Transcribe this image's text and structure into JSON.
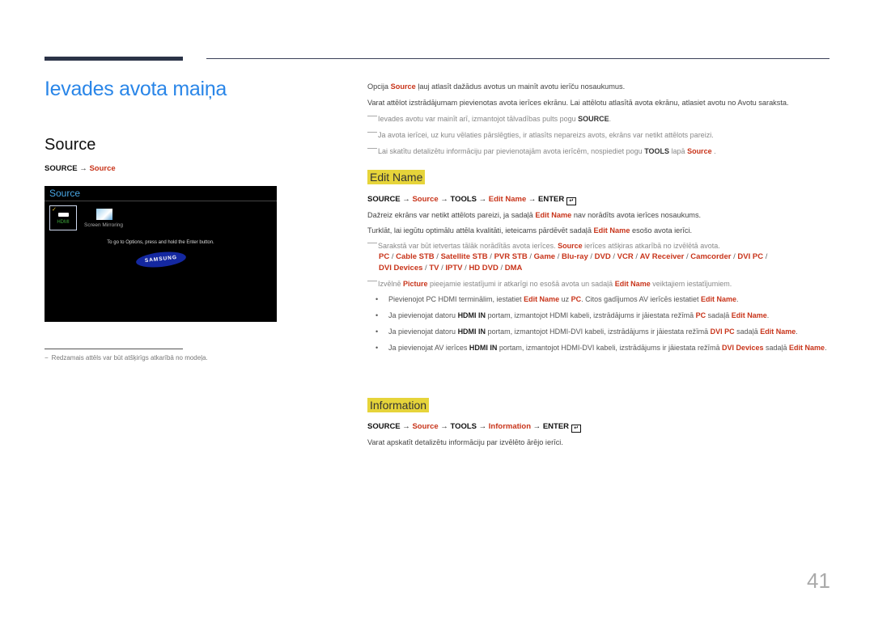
{
  "page_title": "Ievades avota maiņa",
  "section_title": "Source",
  "left_path": {
    "root": "SOURCE",
    "arrow": "→",
    "item": "Source"
  },
  "tv_screen": {
    "title": "Source",
    "hdmi_label": "HDMI",
    "checkmark": "✓",
    "mirror_label": "Screen Mirroring",
    "hint": "To go to Options, press and hold the Enter button.",
    "brand": "SAMSUNG"
  },
  "footnote": {
    "dash": "−",
    "text": "Redzamais attēls var būt atšķirīgs atkarībā no modeļa."
  },
  "intro": {
    "p1_pre": "Opcija ",
    "p1_hl": "Source",
    "p1_post": " ļauj atlasīt dažādus avotus un mainīt avotu ierīču nosaukumus.",
    "p2": "Varat attēlot izstrādājumam pievienotas avota ierīces ekrānu. Lai attēlotu atlasītā avota ekrānu, atlasiet avotu no Avotu saraksta.",
    "n1_pre": "Ievades avotu var mainīt arī, izmantojot tālvadības pults pogu ",
    "n1_b": "SOURCE",
    "n1_post": ".",
    "n2": "Ja avota ierīcei, uz kuru vēlaties pārslēgties, ir atlasīts nepareizs avots, ekrāns var netikt attēlots pareizi.",
    "n3_pre": "Lai skatītu detalizētu informāciju par pievienotajām avota ierīcēm, nospiediet pogu ",
    "n3_b": "TOOLS",
    "n3_mid": " lapā ",
    "n3_hl": "Source",
    "n3_post": " ."
  },
  "edit_name": {
    "heading": "Edit Name",
    "path": [
      "SOURCE",
      "Source",
      "TOOLS",
      "Edit Name",
      "ENTER"
    ],
    "arrow": "→",
    "enter_glyph": "↵",
    "p1_pre": "Dažreiz ekrāns var netikt attēlots pareizi, ja sadaļā ",
    "p1_hl": "Edit Name",
    "p1_post": " nav norādīts avota ierīces nosaukums.",
    "p2_pre": "Turklāt, lai iegūtu optimālu attēla kvalitāti, ieteicams pārdēvēt sadaļā ",
    "p2_hl": "Edit Name",
    "p2_post": " esošo avota ierīci.",
    "n1_pre": "Sarakstā var būt ietvertas tālāk norādītās avota ierīces. ",
    "n1_hl": "Source",
    "n1_post": " ierīces atšķiras atkarībā no izvēlētā avota.",
    "devices": [
      "PC",
      "Cable STB",
      "Satellite STB",
      "PVR STB",
      "Game",
      "Blu-ray",
      "DVD",
      "VCR",
      "AV Receiver",
      "Camcorder",
      "DVI PC",
      "DVI Devices",
      "TV",
      "IPTV",
      "HD DVD",
      "DMA"
    ],
    "n2_pre": "Izvēlnē ",
    "n2_hl1": "Picture",
    "n2_mid": " pieejamie iestatījumi ir atkarīgi no esošā avota un sadaļā ",
    "n2_hl2": "Edit Name",
    "n2_post": " veiktajiem iestatījumiem.",
    "bullets": [
      {
        "a": "Pievienojot PC HDMI terminālim, iestatiet ",
        "b": "Edit Name",
        "c": " uz ",
        "d": "PC",
        "e": ". Citos gadījumos AV ierīcēs iestatiet ",
        "f": "Edit Name",
        "g": "."
      },
      {
        "a": "Ja pievienojat datoru ",
        "b": "HDMI IN",
        "c": " portam, izmantojot HDMI kabeli, izstrādājums ir jāiestata režīmā ",
        "d": "PC",
        "e": " sadaļā ",
        "f": "Edit Name",
        "g": "."
      },
      {
        "a": "Ja pievienojat datoru ",
        "b": "HDMI IN",
        "c": "  portam, izmantojot HDMI-DVI kabeli, izstrādājums ir jāiestata režīmā ",
        "d": "DVI PC",
        "e": " sadaļā ",
        "f": "Edit Name",
        "g": "."
      },
      {
        "a": "Ja pievienojat AV ierīces ",
        "b": "HDMI IN",
        "c": "  portam, izmantojot HDMI-DVI kabeli, izstrādājums ir jāiestata režīmā ",
        "d": "DVI Devices",
        "e": " sadaļā ",
        "f": "Edit Name",
        "g": "."
      }
    ]
  },
  "information": {
    "heading": "Information",
    "path": [
      "SOURCE",
      "Source",
      "TOOLS",
      "Information",
      "ENTER"
    ],
    "p1": "Varat apskatīt detalizētu informāciju par izvēlēto ārējo ierīci."
  },
  "page_number": "41",
  "bullet_glyph": "•"
}
